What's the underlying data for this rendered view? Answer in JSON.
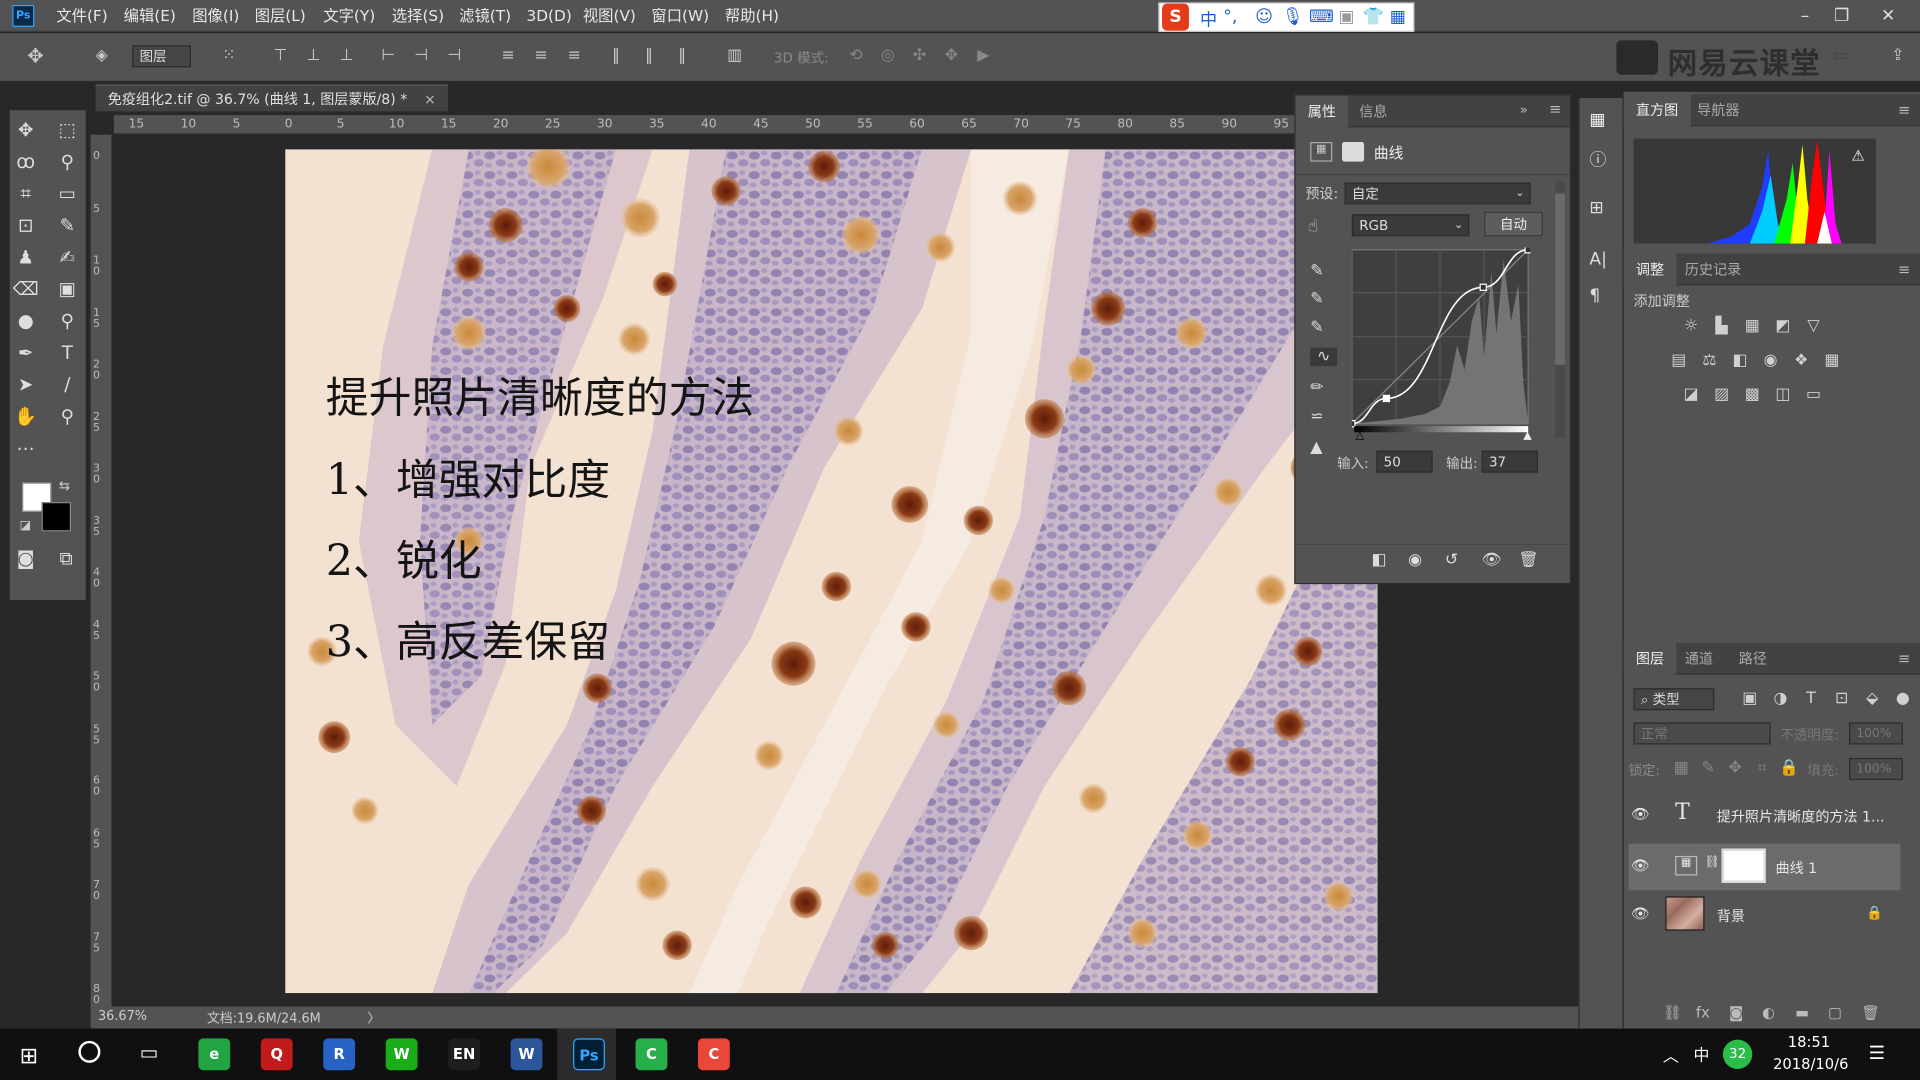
{
  "app": {
    "logo": "Ps"
  },
  "menu": [
    "文件(F)",
    "编辑(E)",
    "图像(I)",
    "图层(L)",
    "文字(Y)",
    "选择(S)",
    "滤镜(T)",
    "3D(D)",
    "视图(V)",
    "窗口(W)",
    "帮助(H)"
  ],
  "ime": {
    "brand": "S",
    "lang": "中",
    "punct": "°,"
  },
  "options": {
    "auto_select": "图层",
    "mode_3d": "3D 模式:"
  },
  "watermark": "网易云课堂",
  "document": {
    "tab": "免疫组化2.tif @ 36.7% (曲线 1, 图层蒙版/8) *",
    "close": "×"
  },
  "ruler": {
    "h_labels": [
      "15",
      "10",
      "5",
      "0",
      "5",
      "10",
      "15",
      "20",
      "25",
      "30",
      "35",
      "40",
      "45",
      "50",
      "55",
      "60",
      "65",
      "70",
      "75",
      "80",
      "85",
      "90",
      "95"
    ],
    "v_labels": [
      "0",
      "5",
      "1 0",
      "1 5",
      "2 0",
      "2 5",
      "3 0",
      "3 5",
      "4 0",
      "4 5",
      "5 0",
      "5 5",
      "6 0",
      "6 5",
      "7 0",
      "7 5",
      "8 0"
    ]
  },
  "canvas_text": {
    "title": "提升照片清晰度的方法",
    "item1": "1、增强对比度",
    "item2": "2、锐化",
    "item3": "3、高反差保留"
  },
  "status": {
    "zoom": "36.67%",
    "doc": "文档:19.6M/24.6M",
    "arrow": "〉"
  },
  "properties": {
    "tabs": [
      "属性",
      "信息"
    ],
    "adjust_name": "曲线",
    "preset_label": "预设:",
    "preset_value": "自定",
    "channel": "RGB",
    "auto_btn": "自动",
    "input_label": "输入:",
    "input_value": "50",
    "output_label": "输出:",
    "output_value": "37",
    "curve_points": [
      [
        0,
        0
      ],
      [
        50,
        37
      ],
      [
        190,
        200
      ],
      [
        255,
        255
      ]
    ]
  },
  "histogram": {
    "tabs": [
      "直方图",
      "导航器"
    ],
    "warning": "⚠"
  },
  "adjustments": {
    "tabs": [
      "调整",
      "历史记录"
    ],
    "add_label": "添加调整"
  },
  "layers": {
    "tabs": [
      "图层",
      "通道",
      "路径"
    ],
    "filter_label": "类型",
    "blend_mode": "正常",
    "opacity_label": "不透明度:",
    "opacity_value": "100%",
    "lock_label": "锁定:",
    "fill_label": "填充:",
    "fill_value": "100%",
    "items": [
      {
        "name": "提升照片清晰度的方法 1...",
        "type": "text"
      },
      {
        "name": "曲线 1",
        "type": "curves"
      },
      {
        "name": "背景",
        "type": "image",
        "locked": true
      }
    ]
  },
  "taskbar": {
    "time": "18:51",
    "date": "2018/10/6",
    "ime": "中",
    "badge": "32",
    "apps": [
      {
        "label": "e",
        "color": "#23a442"
      },
      {
        "label": "Q",
        "color": "#c21b1b"
      },
      {
        "label": "R",
        "color": "#2663c4"
      },
      {
        "label": "W",
        "color": "#1aad19"
      },
      {
        "label": "EN",
        "color": "#1e1e1e"
      },
      {
        "label": "W",
        "color": "#2b579a"
      },
      {
        "label": "Ps",
        "color": "#001e36"
      },
      {
        "label": "C",
        "color": "#27b04a"
      },
      {
        "label": "C",
        "color": "#e8473a"
      }
    ]
  }
}
